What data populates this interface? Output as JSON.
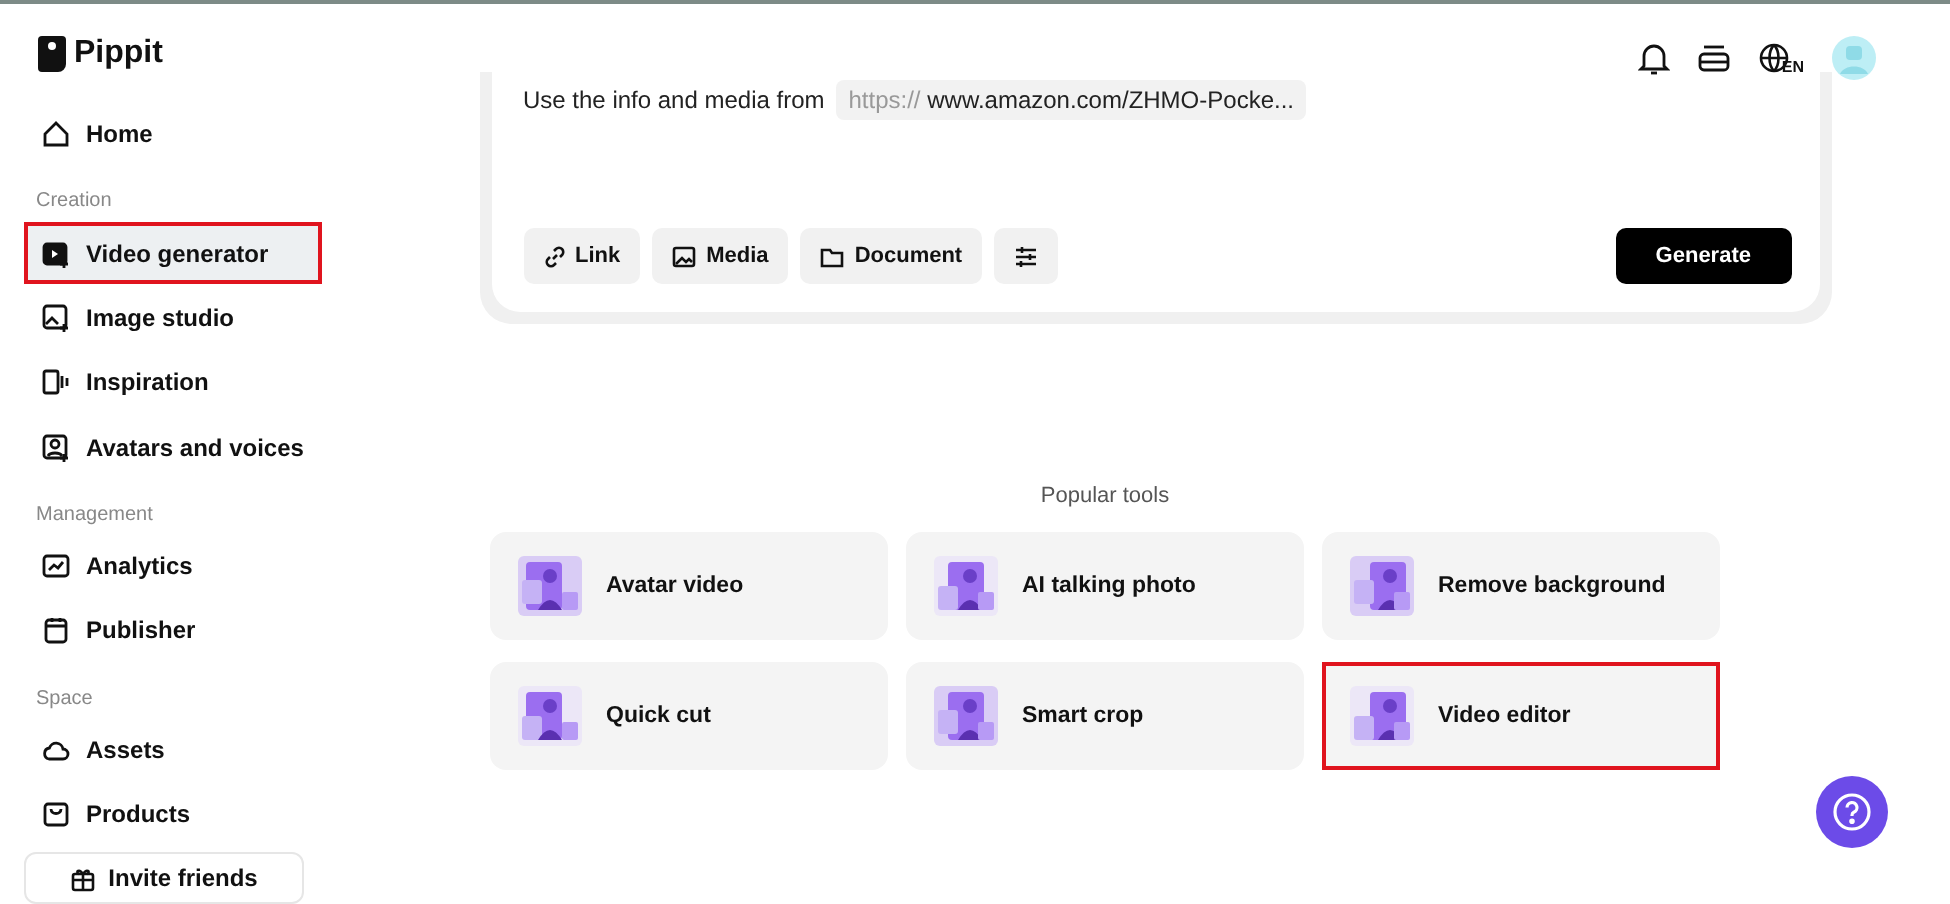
{
  "logo": {
    "text": "Pippit"
  },
  "sidebar": {
    "items": [
      {
        "kind": "item",
        "label": "Home",
        "selected": false,
        "highlighted": false
      },
      {
        "kind": "section",
        "label": "Creation"
      },
      {
        "kind": "item",
        "label": "Video generator",
        "selected": true,
        "highlighted": true
      },
      {
        "kind": "item",
        "label": "Image studio",
        "selected": false,
        "highlighted": false
      },
      {
        "kind": "item",
        "label": "Inspiration",
        "selected": false,
        "highlighted": false
      },
      {
        "kind": "item",
        "label": "Avatars and voices",
        "selected": false,
        "highlighted": false
      },
      {
        "kind": "section",
        "label": "Management"
      },
      {
        "kind": "item",
        "label": "Analytics",
        "selected": false,
        "highlighted": false
      },
      {
        "kind": "item",
        "label": "Publisher",
        "selected": false,
        "highlighted": false
      },
      {
        "kind": "section",
        "label": "Space"
      },
      {
        "kind": "item",
        "label": "Assets",
        "selected": false,
        "highlighted": false
      },
      {
        "kind": "item",
        "label": "Products",
        "selected": false,
        "highlighted": false
      }
    ],
    "invite_button": "Invite friends"
  },
  "header": {
    "language": "EN"
  },
  "prompt_card": {
    "text": "Use the info and media from",
    "link_prefix": "https://",
    "link": "www.amazon.com/ZHMO-Pocke...",
    "buttons": [
      {
        "kind": "link",
        "label": "Link"
      },
      {
        "kind": "media",
        "label": "Media"
      },
      {
        "kind": "document",
        "label": "Document"
      },
      {
        "kind": "settings"
      }
    ],
    "generate_button": "Generate"
  },
  "popular_tools": {
    "title": "Popular tools",
    "tools": [
      {
        "label": "Avatar video",
        "highlighted": false
      },
      {
        "label": "AI talking photo",
        "highlighted": false
      },
      {
        "label": "Remove background",
        "highlighted": false
      },
      {
        "label": "Quick cut",
        "highlighted": false
      },
      {
        "label": "Smart crop",
        "highlighted": false
      },
      {
        "label": "Video editor",
        "highlighted": true
      }
    ]
  }
}
